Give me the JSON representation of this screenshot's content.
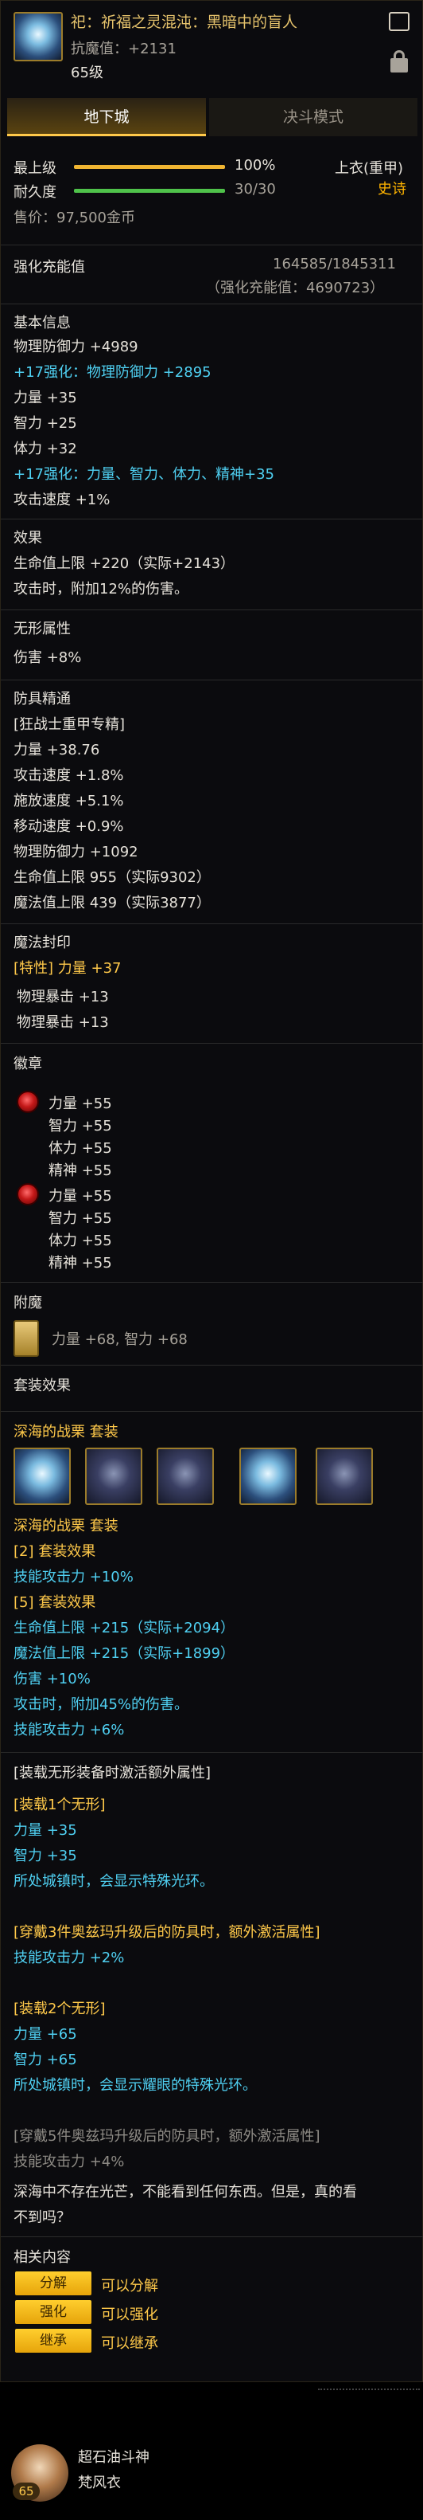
{
  "header": {
    "item_name": "祀：祈福之灵混沌：黑暗中的盲人",
    "anti_magic": "抗魔值：+2131",
    "level": "65级"
  },
  "tabs": [
    "地下城",
    "决斗模式"
  ],
  "stats": {
    "max_level_label": "最上级",
    "max_level_value": "100%",
    "max_level_fill": 1.0,
    "durability_label": "耐久度",
    "durability_value": "30/30",
    "durability_fill": 1.0,
    "price": "售价：97,500金币",
    "slot": "上衣(重甲)",
    "rarity": "史诗"
  },
  "amp": {
    "label": "强化充能值",
    "value": "164585/1845311",
    "value2": "（强化充能值：4690723）"
  },
  "basic": {
    "title": "基本信息",
    "lines": [
      "物理防御力 +4989",
      "+17强化：物理防御力 +2895",
      "力量 +35",
      "智力 +25",
      "体力 +32",
      "+17强化：力量、智力、体力、精神+35",
      "攻击速度 +1%"
    ]
  },
  "effect": {
    "title": "效果",
    "lines": [
      "生命值上限 +220（实际+2143）",
      "攻击时，附加12%的伤害。"
    ]
  },
  "shapeless": {
    "title": "无形属性",
    "lines": [
      "伤害 +8%"
    ]
  },
  "mastery": {
    "title": "防具精通",
    "lines": [
      "[狂战士重甲专精]",
      "力量 +38.76",
      "攻击速度 +1.8%",
      "施放速度 +5.1%",
      "移动速度 +0.9%",
      "物理防御力 +1092",
      "生命值上限 955（实际9302）",
      "魔法值上限 439（实际3877）"
    ]
  },
  "seal": {
    "title": "魔法封印",
    "lines": [
      "[特性] 力量 +37",
      "物理暴击 +13",
      "物理暴击 +13"
    ]
  },
  "emblem": {
    "title": "徽章",
    "a": [
      "力量 +55",
      "智力 +55",
      "体力 +55",
      "精神 +55"
    ],
    "b": [
      "力量 +55",
      "智力 +55",
      "体力 +55",
      "精神 +55"
    ]
  },
  "enchant": {
    "title": "附魔",
    "text": "力量 +68, 智力 +68"
  },
  "set": {
    "title": "套装效果",
    "name": "深海的战栗  套装",
    "name2": "深海的战栗  套装",
    "lines": [
      "[2] 套装效果",
      "技能攻击力 +10%",
      "[5] 套装效果",
      "生命值上限 +215（实际+2094）",
      "魔法值上限 +215（实际+1899）",
      "伤害 +10%",
      "攻击时，附加45%的伤害。",
      "技能攻击力 +6%"
    ]
  },
  "extra": {
    "title": "[装载无形装备时激活额外属性]",
    "g1": [
      "[装载1个无形]",
      "力量 +35",
      "智力 +35",
      "所处城镇时，会显示特殊光环。"
    ],
    "g2": [
      "[穿戴3件奥兹玛升级后的防具时，额外激活属性]",
      "技能攻击力 +2%"
    ],
    "g3": [
      "[装载2个无形]",
      "力量 +65",
      "智力 +65",
      "所处城镇时，会显示耀眼的特殊光环。"
    ],
    "g4": [
      "[穿戴5件奥兹玛升级后的防具时，额外激活属性]",
      "技能攻击力 +4%"
    ],
    "flavor": [
      "深海中不存在光芒，不能看到任何东西。但是，真的看",
      "不到吗？"
    ]
  },
  "related": {
    "title": "相关内容",
    "items": [
      {
        "btn": "分解",
        "text": "可以分解"
      },
      {
        "btn": "强化",
        "text": "可以强化"
      },
      {
        "btn": "继承",
        "text": "可以继承"
      }
    ]
  },
  "footer": {
    "name": "超石油斗神",
    "sub": "梵风衣",
    "badge": "65"
  },
  "colors": {
    "accent": "#ffc94a",
    "cyan": "#4fd0f2",
    "rarity": "#ffb400"
  }
}
